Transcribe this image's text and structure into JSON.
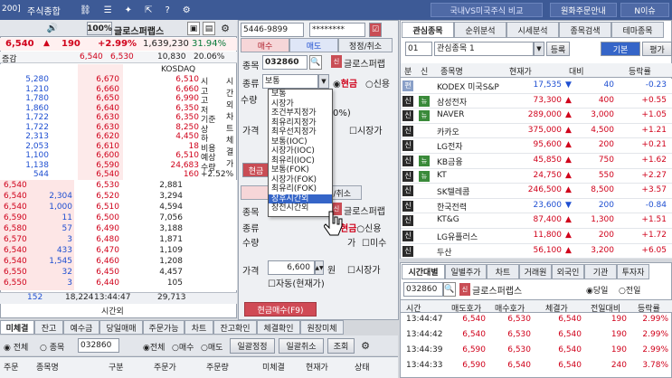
{
  "topbar": {
    "screen_code": "200]",
    "title": "주식종합",
    "market_link": "국내VS미국주식 비교",
    "currency_btn": "원화주문안내",
    "news_btn": "N이슈"
  },
  "left": {
    "code_badge": "100%",
    "stock_name": "글로스퍼랩스",
    "price": "6,540",
    "change": "190",
    "change_pct": "+2.99%",
    "volume": "1,639,230",
    "vol_pct": "31.94%",
    "label_prev": "증감",
    "prev_val": "6,540",
    "prev_price": "6,530",
    "strength": "10,830",
    "strength_pct": "20.06%",
    "kosdaq_label": "KOSDAQ",
    "ask_rows": [
      {
        "qty": "5,280",
        "price": "6,670",
        "side": "6,510",
        "tag": "시"
      },
      {
        "qty": "1,210",
        "price": "6,660",
        "side": "6,660",
        "tag": "고"
      },
      {
        "qty": "1,780",
        "price": "6,650",
        "side": "6,990",
        "tag": "고"
      },
      {
        "qty": "1,860",
        "price": "6,640",
        "side": "6,350",
        "tag": "저"
      },
      {
        "qty": "1,722",
        "price": "6,630",
        "side": "6,350",
        "tag": "기준"
      },
      {
        "qty": "1,722",
        "price": "6,630",
        "side": "8,250",
        "tag": "상"
      },
      {
        "qty": "2,313",
        "price": "6,620",
        "side": "4,450",
        "tag": "하"
      },
      {
        "qty": "2,053",
        "price": "6,610",
        "side": "18",
        "tag": "비용"
      },
      {
        "qty": "1,100",
        "price": "6,600",
        "side": "6,510",
        "tag": "예상"
      },
      {
        "qty": "1,138",
        "price": "6,590",
        "side": "24,683",
        "tag": "수량"
      },
      {
        "qty": "544",
        "price": "6,540",
        "side": "160",
        "tag": "+2.52%"
      }
    ],
    "side_tabs": [
      "시",
      "간",
      "외",
      "차",
      "트",
      "체",
      "결",
      "가"
    ],
    "ask_total_left": "152",
    "bid_rows": [
      {
        "qty": "6,540",
        "sub": "",
        "price": "6,530",
        "vol": "2,881"
      },
      {
        "qty": "6,540",
        "sub": "2,304",
        "price": "6,520",
        "vol": "3,294"
      },
      {
        "qty": "6,540",
        "sub": "1,000",
        "price": "6,510",
        "vol": "4,594"
      },
      {
        "qty": "6,590",
        "sub": "11",
        "price": "6,500",
        "vol": "7,056"
      },
      {
        "qty": "6,580",
        "sub": "57",
        "price": "6,490",
        "vol": "3,188"
      },
      {
        "qty": "6,570",
        "sub": "3",
        "price": "6,480",
        "vol": "1,871"
      },
      {
        "qty": "6,540",
        "sub": "433",
        "price": "6,470",
        "vol": "1,109"
      },
      {
        "qty": "6,540",
        "sub": "1,545",
        "price": "6,460",
        "vol": "1,208"
      },
      {
        "qty": "6,550",
        "sub": "32",
        "price": "6,450",
        "vol": "4,457"
      },
      {
        "qty": "6,550",
        "sub": "3",
        "price": "6,440",
        "vol": "105"
      }
    ],
    "total_left": "152",
    "total_qty": "18,224",
    "time": "13:44:47",
    "total_right": "29,713",
    "after_hours": "시간외",
    "bottom_tabs": [
      "미체결",
      "잔고",
      "예수금",
      "당일매매",
      "주문가능",
      "차트",
      "잔고확인",
      "체결확인",
      "원장미체"
    ],
    "radio_all": "전체",
    "radio_stock": "종목",
    "code": "032860",
    "radio2_all": "전체",
    "radio2_buy": "매수",
    "radio2_sell": "매도",
    "btn_batch_fix": "일괄정정",
    "btn_batch_cancel": "일괄취소",
    "btn_query": "조회",
    "col_headers": [
      "주문",
      "종목명",
      "구분",
      "주문가",
      "주문량",
      "미체결",
      "현재가",
      "상태"
    ]
  },
  "order": {
    "account": "5446-9899",
    "password": "********",
    "tabs": [
      "매수",
      "매도",
      "정정/취소"
    ],
    "label_code": "종목",
    "code": "032860",
    "name": "글로스퍼랩",
    "label_type": "종류",
    "type_value": "보통",
    "radio_cash": "현금",
    "radio_credit": "신용",
    "label_qty": "수량",
    "qty_pct": "0%)",
    "label_price": "가격",
    "market_price": "시장가",
    "cash_btn": "현금",
    "dropdown": [
      "보통",
      "시장가",
      "조건부지정가",
      "최유리지정가",
      "최우선지정가",
      "보통(IOC)",
      "시장가(IOC)",
      "최유리(IOC)",
      "보통(FOK)",
      "시장가(FOK)",
      "최유리(FOK)",
      "장후시간외",
      "장전시간외"
    ],
    "dropdown_selected": 11,
    "lower_tabs": [
      "매",
      "정정/취소"
    ],
    "lower_code_label": "종목",
    "lower_name": "글로스퍼랩",
    "lower_type_label": "종류",
    "lower_cash": "현금",
    "lower_credit": "신용",
    "lower_qty_label": "수량",
    "lower_mid": "가",
    "lower_mid2": "미수",
    "lower_price_label": "가격",
    "lower_price": "6,600",
    "unit": "원",
    "lower_market": "시장가",
    "auto_label": "자동(현재가)",
    "submit_btn": "현금매수(F9)"
  },
  "watch": {
    "tabs": [
      "관심종목",
      "순위분석",
      "시세분석",
      "종목검색",
      "테마종목"
    ],
    "group_no": "01",
    "group_name": "관심종목 1",
    "register_btn": "등록",
    "basic_btn": "기본",
    "eval_btn": "평가",
    "headers": [
      "분",
      "신",
      "종목명",
      "현재가",
      "대비",
      "등락률"
    ],
    "rows": [
      {
        "tag": "편",
        "new": "",
        "name": "KODEX 미국S&P",
        "price": "17,535",
        "arrow": "▼",
        "diff": "40",
        "rate": "-0.23",
        "dir": "down"
      },
      {
        "tag": "신",
        "new": "뉴",
        "name": "삼성전자",
        "price": "73,300",
        "arrow": "▲",
        "diff": "400",
        "rate": "+0.55",
        "dir": "up"
      },
      {
        "tag": "신",
        "new": "뉴",
        "name": "NAVER",
        "price": "289,000",
        "arrow": "▲",
        "diff": "3,000",
        "rate": "+1.05",
        "dir": "up"
      },
      {
        "tag": "신",
        "new": "",
        "name": "카카오",
        "price": "375,000",
        "arrow": "▲",
        "diff": "4,500",
        "rate": "+1.21",
        "dir": "up"
      },
      {
        "tag": "신",
        "new": "",
        "name": "LG전자",
        "price": "95,600",
        "arrow": "▲",
        "diff": "200",
        "rate": "+0.21",
        "dir": "up"
      },
      {
        "tag": "신",
        "new": "뉴",
        "name": "KB금융",
        "price": "45,850",
        "arrow": "▲",
        "diff": "750",
        "rate": "+1.62",
        "dir": "up"
      },
      {
        "tag": "신",
        "new": "뉴",
        "name": "KT",
        "price": "24,750",
        "arrow": "▲",
        "diff": "550",
        "rate": "+2.27",
        "dir": "up"
      },
      {
        "tag": "신",
        "new": "",
        "name": "SK텔레콤",
        "price": "246,500",
        "arrow": "▲",
        "diff": "8,500",
        "rate": "+3.57",
        "dir": "up"
      },
      {
        "tag": "신",
        "new": "",
        "name": "한국전력",
        "price": "23,600",
        "arrow": "▼",
        "diff": "200",
        "rate": "-0.84",
        "dir": "down"
      },
      {
        "tag": "신",
        "new": "",
        "name": "KT&G",
        "price": "87,400",
        "arrow": "▲",
        "diff": "1,300",
        "rate": "+1.51",
        "dir": "up"
      },
      {
        "tag": "신",
        "new": "",
        "name": "LG유플러스",
        "price": "11,800",
        "arrow": "▲",
        "diff": "200",
        "rate": "+1.72",
        "dir": "up"
      },
      {
        "tag": "신",
        "new": "",
        "name": "두산",
        "price": "56,100",
        "arrow": "▲",
        "diff": "3,200",
        "rate": "+6.05",
        "dir": "up"
      }
    ],
    "trade_tabs": [
      "시간대별",
      "일별주가",
      "차트",
      "거래원",
      "외국인",
      "기관",
      "투자자"
    ],
    "trade_code": "032860",
    "trade_name": "글로스퍼랩스",
    "radio_today": "당일",
    "radio_prev": "전일",
    "trade_headers": [
      "시간",
      "매도호가",
      "매수호가",
      "체결가",
      "전일대비",
      "등락률"
    ],
    "trades": [
      {
        "time": "13:44:47",
        "ask": "6,540",
        "bid": "6,530",
        "price": "6,540",
        "diff": "190",
        "rate": "2.99%"
      },
      {
        "time": "13:44:42",
        "ask": "6,540",
        "bid": "6,530",
        "price": "6,540",
        "diff": "190",
        "rate": "2.99%"
      },
      {
        "time": "13:44:39",
        "ask": "6,590",
        "bid": "6,530",
        "price": "6,540",
        "diff": "190",
        "rate": "2.99%"
      },
      {
        "time": "13:44:33",
        "ask": "6,590",
        "bid": "6,540",
        "price": "6,540",
        "diff": "240",
        "rate": "3.78%"
      }
    ]
  },
  "colors": {
    "accent_red": "#d0021b",
    "accent_blue": "#1f4fd1",
    "title_bar": "#3d5a96",
    "selection": "#3565c8"
  }
}
